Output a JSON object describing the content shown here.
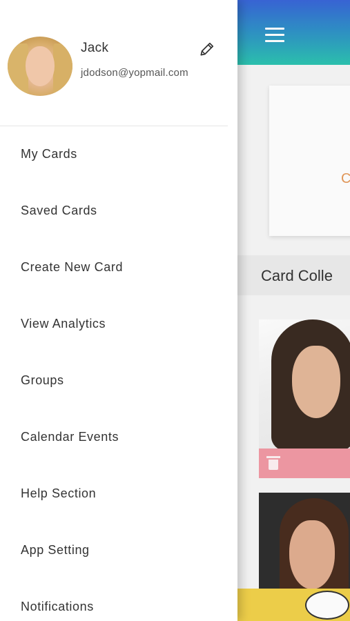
{
  "app": {
    "collection_title": "Card Colle",
    "top_card_letter": "C"
  },
  "profile": {
    "name": "Jack",
    "email": "jdodson@yopmail.com"
  },
  "menu": {
    "items": [
      {
        "label": "My Cards"
      },
      {
        "label": "Saved Cards"
      },
      {
        "label": "Create New Card"
      },
      {
        "label": "View Analytics"
      },
      {
        "label": "Groups"
      },
      {
        "label": "Calendar Events"
      },
      {
        "label": "Help Section"
      },
      {
        "label": "App Setting"
      },
      {
        "label": "Notifications"
      }
    ]
  },
  "icons": {
    "menu": "hamburger-menu-icon",
    "edit": "pencil-icon",
    "delete": "trash-icon"
  },
  "colors": {
    "header_gradient_top": "#3a66d8",
    "header_gradient_bottom": "#2cc3b0",
    "delete_bar": "#f19aa5",
    "accent_letter": "#e59a5a"
  }
}
